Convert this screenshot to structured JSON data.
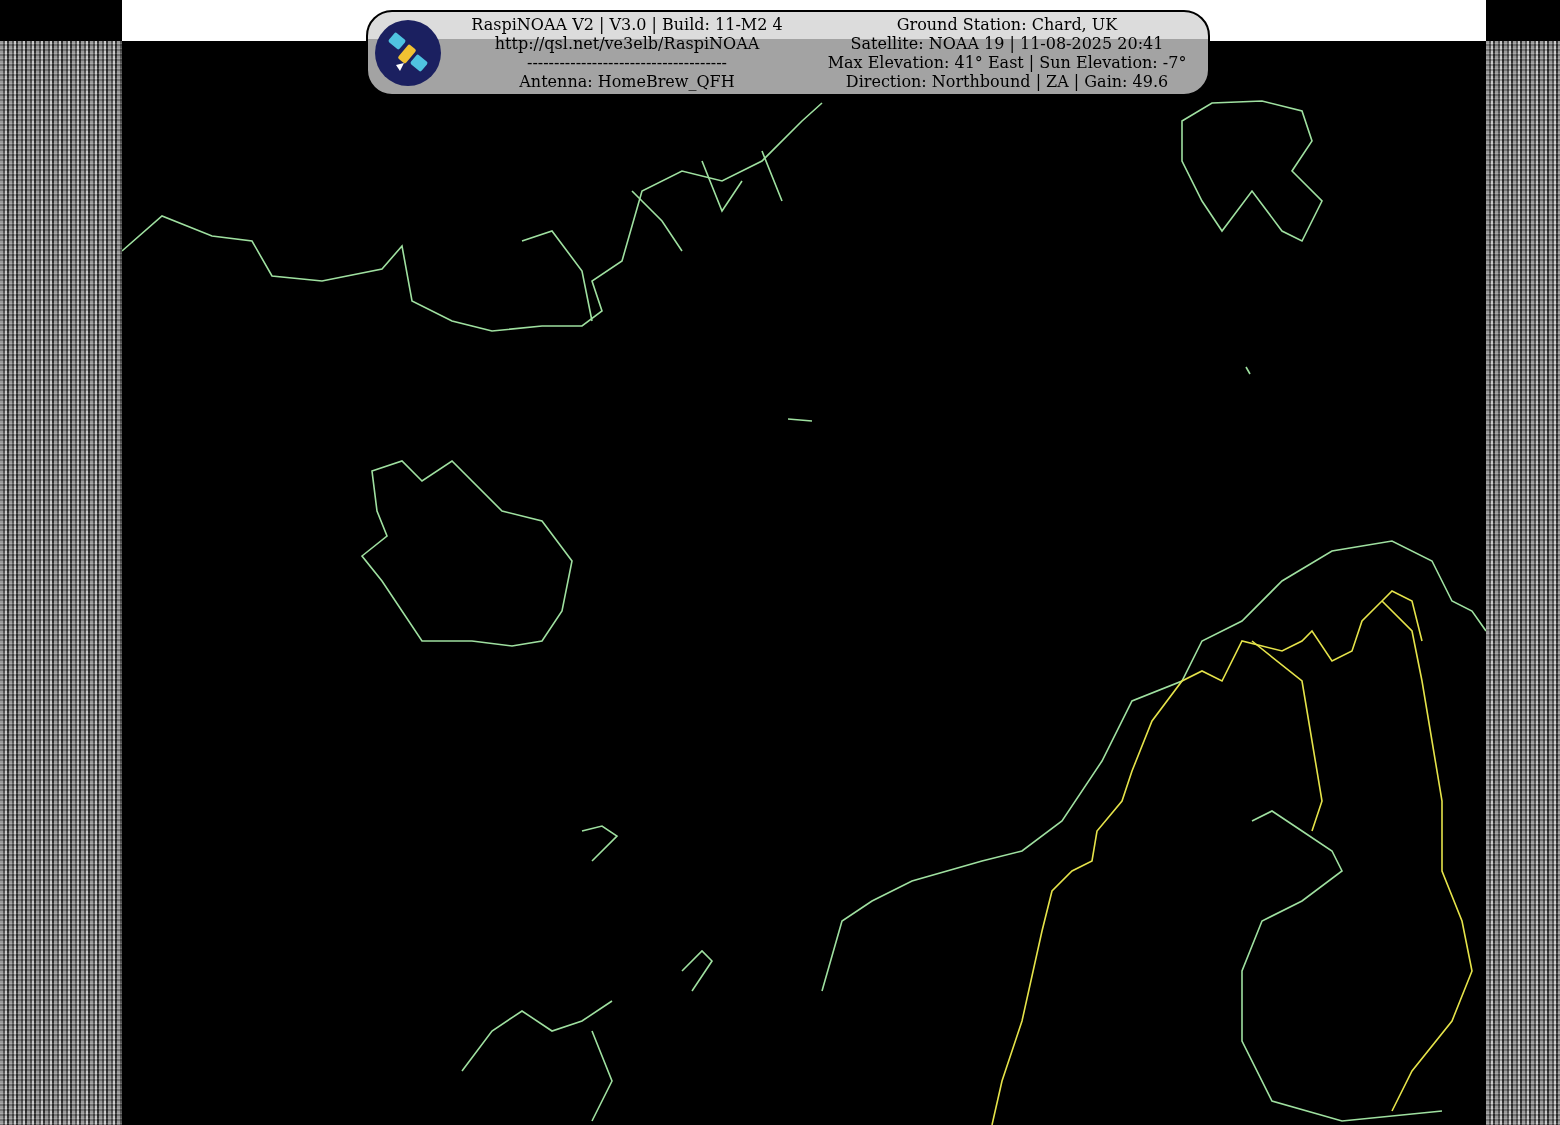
{
  "header": {
    "left_lines": [
      "RaspiNOAA V2 | V3.0 | Build: 11-M2 4",
      "http://qsl.net/ve3elb/RaspiNOAA",
      "-------------------------------------",
      "Antenna: HomeBrew_QFH"
    ],
    "right_lines": [
      "Ground Station: Chard, UK",
      "Satellite: NOAA 19 | 11-08-2025 20:41",
      "Max Elevation: 41° East | Sun Elevation: -7°",
      "Direction: Northbound | ZA | Gain: 49.6"
    ]
  }
}
